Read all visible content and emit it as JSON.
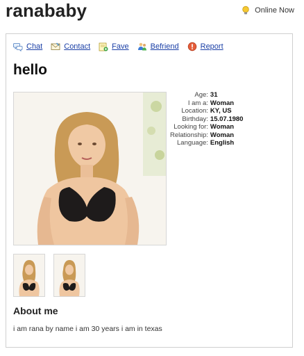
{
  "profile": {
    "username": "ranababy",
    "status": "Online Now",
    "headline": "hello"
  },
  "actions": [
    {
      "label": "Chat",
      "icon": "chat-icon"
    },
    {
      "label": "Contact",
      "icon": "contact-icon"
    },
    {
      "label": "Fave",
      "icon": "fave-icon"
    },
    {
      "label": "Befriend",
      "icon": "befriend-icon"
    },
    {
      "label": "Report",
      "icon": "report-icon"
    }
  ],
  "details": [
    {
      "key": "Age:",
      "value": "31"
    },
    {
      "key": "I am a:",
      "value": "Woman"
    },
    {
      "key": "Location:",
      "value": "KY, US"
    },
    {
      "key": "Birthday:",
      "value": "15.07.1980"
    },
    {
      "key": "Looking for:",
      "value": "Woman"
    },
    {
      "key": "Relationship:",
      "value": "Woman"
    },
    {
      "key": "Language:",
      "value": "English"
    }
  ],
  "about": {
    "title": "About me",
    "text": "i am rana by name i am 30 years i am in texas"
  },
  "colors": {
    "link": "#1a3fa6",
    "border": "#cfcfcf"
  }
}
